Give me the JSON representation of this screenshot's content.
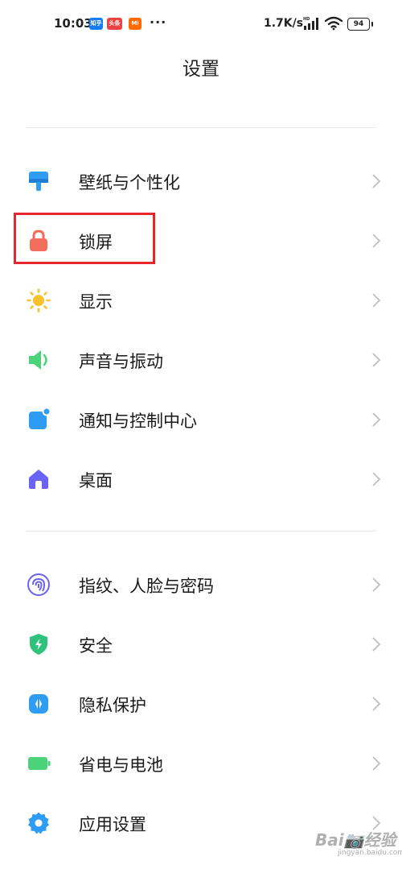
{
  "status_bar": {
    "time": "10:03",
    "apps": [
      {
        "name": "知乎",
        "color": "#1a7cf2"
      },
      {
        "name": "头条",
        "color": "#f04142"
      },
      {
        "name": "Mi",
        "color": "#ff6900"
      }
    ],
    "more": "···",
    "net_speed": "1.7K/s",
    "battery": "94"
  },
  "page": {
    "title": "设置"
  },
  "settings": {
    "group1": [
      {
        "label": "壁纸与个性化",
        "icon": "wallpaper-icon",
        "color": "#2f9cf4"
      },
      {
        "label": "锁屏",
        "icon": "lock-icon",
        "color": "#f26d5b"
      },
      {
        "label": "显示",
        "icon": "sun-icon",
        "color": "#f8c22c"
      },
      {
        "label": "声音与振动",
        "icon": "speaker-icon",
        "color": "#4cd37a"
      },
      {
        "label": "通知与控制中心",
        "icon": "notification-icon",
        "color": "#2f9cf4"
      },
      {
        "label": "桌面",
        "icon": "home-icon",
        "color": "#6a63f3"
      }
    ],
    "group2": [
      {
        "label": "指纹、人脸与密码",
        "icon": "fingerprint-icon",
        "color": "#6a63f3"
      },
      {
        "label": "安全",
        "icon": "shield-icon",
        "color": "#2fc27c"
      },
      {
        "label": "隐私保护",
        "icon": "privacy-icon",
        "color": "#2f9cf4"
      },
      {
        "label": "省电与电池",
        "icon": "battery-icon",
        "color": "#4cd37a"
      },
      {
        "label": "应用设置",
        "icon": "gear-icon",
        "color": "#2f9cf4"
      }
    ]
  },
  "highlighted_item": "锁屏",
  "highlight_color": "#e8262b",
  "watermark": {
    "text": "Bai📷经验",
    "sub": "jingyan.baidu.com"
  }
}
